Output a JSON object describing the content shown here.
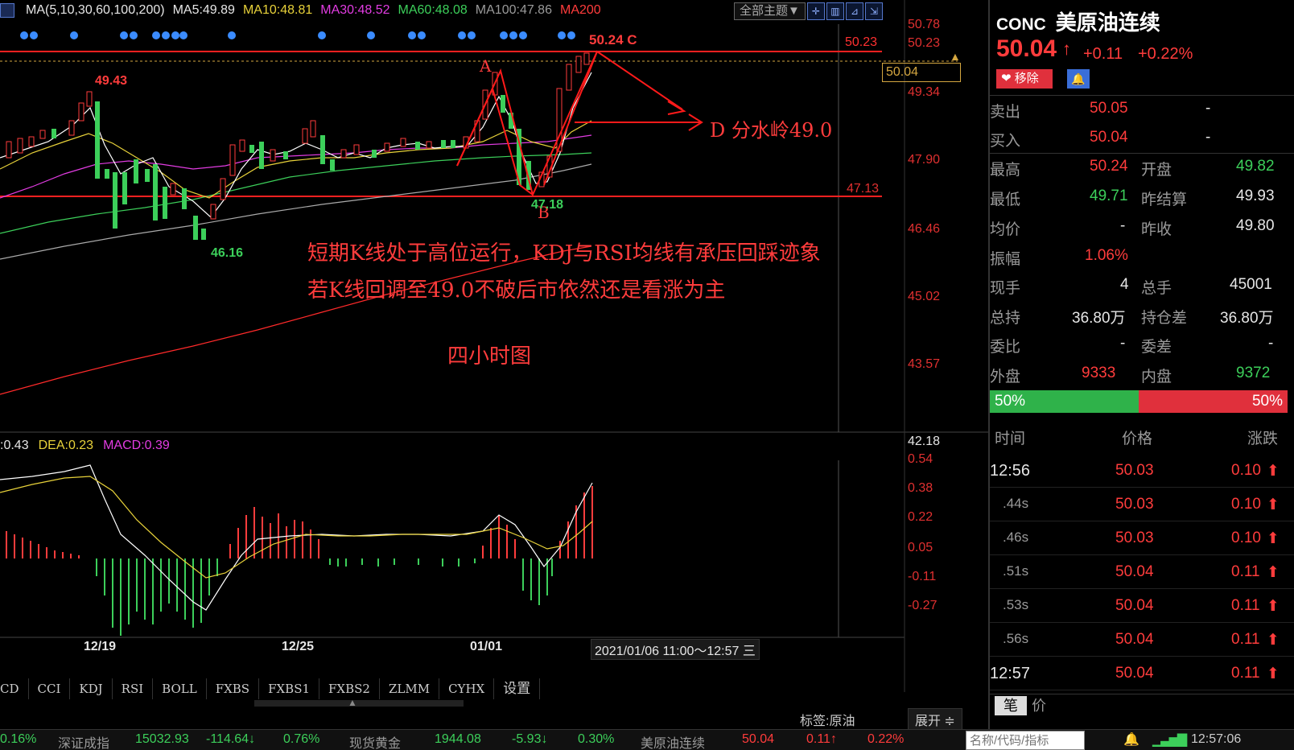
{
  "legend": {
    "ma_title": "MA(5,10,30,60,100,200)",
    "ma5": "MA5:49.89",
    "ma10": "MA10:48.81",
    "ma30": "MA30:48.52",
    "ma60": "MA60:48.08",
    "ma100": "MA100:47.86",
    "ma200": "MA200"
  },
  "toolbar": {
    "theme": "全部主题▼"
  },
  "price_axis": [
    "50.78",
    "50.23",
    "50.04",
    "49.34",
    "47.90",
    "47.13",
    "46.46",
    "45.02",
    "43.57",
    "42.18"
  ],
  "macd_axis": [
    "0.54",
    "0.38",
    "0.22",
    "0.05",
    "-0.11",
    "-0.27"
  ],
  "annotations": {
    "high1": "49.43",
    "low1": "46.16",
    "point_a": "A",
    "point_b": "B",
    "point_c": "50.24 C",
    "low_b": "47.18",
    "point_d": "D 分水岭49.0",
    "note1": "短期K线处于高位运行，KDJ与RSI均线有承压回踩迹象",
    "note2": "若K线回调至49.0不破后市依然还是看涨为主",
    "note3": "四小时图"
  },
  "macd_legend": {
    "diff": ":0.43",
    "dea": "DEA:0.23",
    "macd": "MACD:0.39"
  },
  "x_axis": [
    "12/19",
    "12/25",
    "01/01"
  ],
  "time_range": "2021/01/06 11:00～12:57 三",
  "indicator_tabs": [
    "CD",
    "CCI",
    "KDJ",
    "RSI",
    "BOLL",
    "FXBS",
    "FXBS1",
    "FXBS2",
    "ZLMM",
    "CYHX",
    "设置"
  ],
  "label_bar": {
    "tag": "标签:原油",
    "expand": "展开 ≑"
  },
  "bottom_bar": {
    "items": [
      "0.16%",
      "深证成指",
      "15032.93",
      "-114.64↓",
      "0.76%",
      "现货黄金",
      "1944.08",
      "-5.93↓",
      "0.30%",
      "美原油连续",
      "50.04",
      "0.11↑",
      "0.22%"
    ],
    "search_placeholder": "名称/代码/指标",
    "clock": "12:57:06"
  },
  "quote": {
    "code": "CONC",
    "name": "美原油连续",
    "price": "50.04",
    "change": "+0.11",
    "change_pct": "+0.22%",
    "remove_label": "移除",
    "sell_label": "卖出",
    "sell_price": "50.05",
    "sell_vol": "-",
    "buy_label": "买入",
    "buy_price": "50.04",
    "buy_vol": "-",
    "high_label": "最高",
    "high": "50.24",
    "open_label": "开盘",
    "open": "49.82",
    "low_label": "最低",
    "low": "49.71",
    "prev_settle_label": "昨结算",
    "prev_settle": "49.93",
    "avg_label": "均价",
    "avg": "-",
    "prev_close_label": "昨收",
    "prev_close": "49.80",
    "amp_label": "振幅",
    "amp": "1.06%",
    "cur_vol_label": "现手",
    "cur_vol": "4",
    "total_vol_label": "总手",
    "total_vol": "45001",
    "oi_label": "总持",
    "oi": "36.80万",
    "oi_diff_label": "持仓差",
    "oi_diff": "36.80万",
    "wb_label": "委比",
    "wb": "-",
    "wc_label": "委差",
    "wc": "-",
    "outer_label": "外盘",
    "outer": "9333",
    "inner_label": "内盘",
    "inner": "9372",
    "buy_ratio": "50%",
    "sell_ratio": "50%",
    "buy_ratio_value": 0.5
  },
  "trades": {
    "header": {
      "time": "时间",
      "price": "价格",
      "change": "涨跌"
    },
    "rows": [
      {
        "time": "12:56",
        "price": "50.03",
        "change": "0.10"
      },
      {
        "time": ".44s",
        "price": "50.03",
        "change": "0.10"
      },
      {
        "time": ".46s",
        "price": "50.03",
        "change": "0.10"
      },
      {
        "time": ".51s",
        "price": "50.04",
        "change": "0.11"
      },
      {
        "time": ".53s",
        "price": "50.04",
        "change": "0.11"
      },
      {
        "time": ".56s",
        "price": "50.04",
        "change": "0.11"
      },
      {
        "time": "12:57",
        "price": "50.04",
        "change": "0.11"
      }
    ],
    "tab_bi": "笔",
    "tab_jia": "价"
  }
}
